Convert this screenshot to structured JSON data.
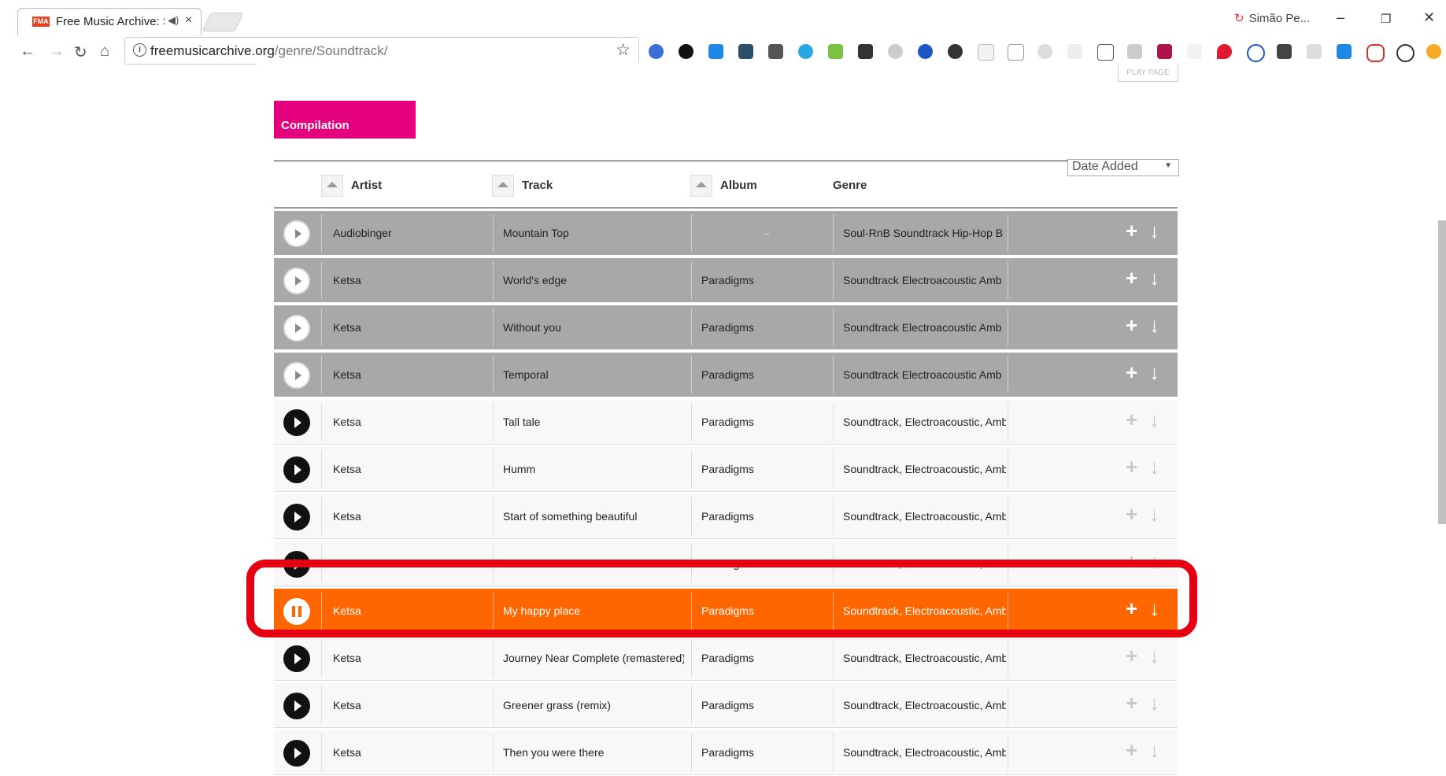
{
  "browser": {
    "tab_title": "Free Music Archive: So",
    "tab_favicon_text": "FMA",
    "profile_name": "Simão Pe...",
    "url_domain": "freemusicarchive.org",
    "url_path": "/genre/Soundtrack/"
  },
  "page": {
    "play_page_label": "PLAY PAGE",
    "compilation_label": "Compilation",
    "sort_select_value": "Date Added",
    "headers": {
      "artist": "Artist",
      "track": "Track",
      "album": "Album",
      "genre": "Genre"
    }
  },
  "tracks": [
    {
      "artist": "Audiobinger",
      "track": "Mountain Top",
      "album": "–",
      "genre": "Soul-RnB  Soundtrack  Hip-Hop B",
      "state": "played"
    },
    {
      "artist": "Ketsa",
      "track": "World's edge",
      "album": "Paradigms",
      "genre": "Soundtrack  Electroacoustic  Amb",
      "state": "played"
    },
    {
      "artist": "Ketsa",
      "track": "Without you",
      "album": "Paradigms",
      "genre": "Soundtrack  Electroacoustic  Amb",
      "state": "played"
    },
    {
      "artist": "Ketsa",
      "track": "Temporal",
      "album": "Paradigms",
      "genre": "Soundtrack  Electroacoustic  Amb",
      "state": "played"
    },
    {
      "artist": "Ketsa",
      "track": "Tall tale",
      "album": "Paradigms",
      "genre": "Soundtrack, Electroacoustic, Amb",
      "state": "normal"
    },
    {
      "artist": "Ketsa",
      "track": "Humm",
      "album": "Paradigms",
      "genre": "Soundtrack, Electroacoustic, Amb",
      "state": "normal"
    },
    {
      "artist": "Ketsa",
      "track": "Start of something beautiful",
      "album": "Paradigms",
      "genre": "Soundtrack, Electroacoustic, Amb",
      "state": "normal"
    },
    {
      "artist": "Ketsa",
      "track": "",
      "album": "Paradigms",
      "genre": "Soundtrack, Electroacoustic, Amb",
      "state": "normal"
    },
    {
      "artist": "Ketsa",
      "track": "My happy place",
      "album": "Paradigms",
      "genre": "Soundtrack, Electroacoustic, Amb",
      "state": "active"
    },
    {
      "artist": "Ketsa",
      "track": "Journey Near Complete (remastered)",
      "album": "Paradigms",
      "genre": "Soundtrack, Electroacoustic, Amb",
      "state": "normal"
    },
    {
      "artist": "Ketsa",
      "track": "Greener grass (remix)",
      "album": "Paradigms",
      "genre": "Soundtrack, Electroacoustic, Amb",
      "state": "normal"
    },
    {
      "artist": "Ketsa",
      "track": "Then you were there",
      "album": "Paradigms",
      "genre": "Soundtrack, Electroacoustic, Amb",
      "state": "normal"
    }
  ],
  "icons": {
    "add": "+",
    "download": "↓"
  },
  "colors": {
    "compilation": "#e4007c",
    "active_row": "#ff6600",
    "played_row": "#a8a8a8",
    "highlight_box": "#e60012"
  }
}
